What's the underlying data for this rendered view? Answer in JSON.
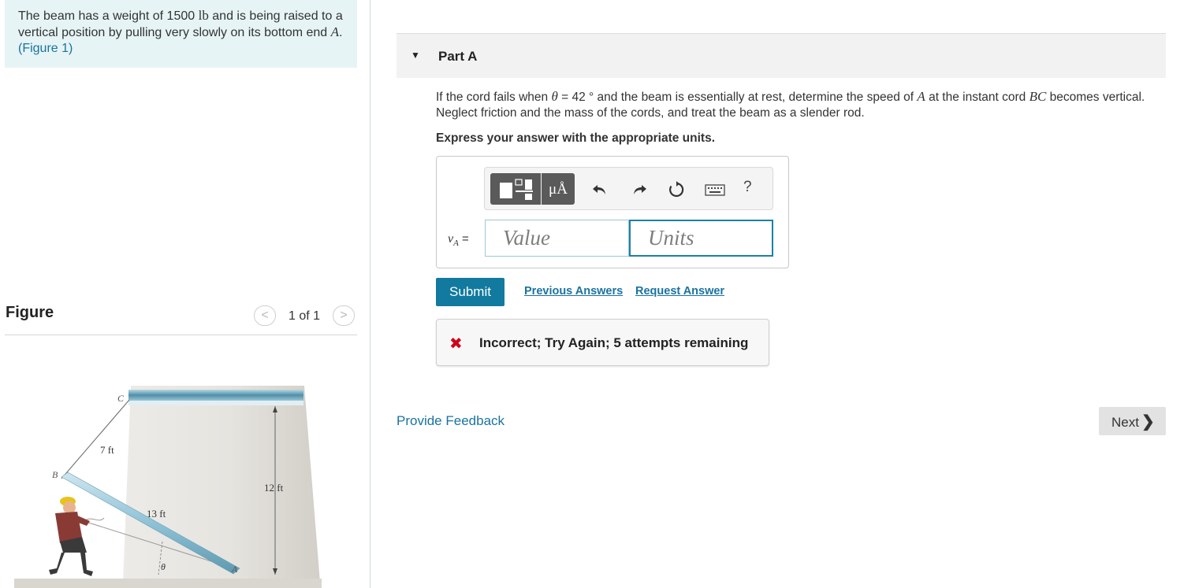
{
  "problem": {
    "text_1": "The beam has a weight of 1500 ",
    "unit_lb": "lb",
    "text_2": " and is being raised to a vertical position by pulling very slowly on its bottom end ",
    "point_a": "A",
    "text_3": ".",
    "figure_link": "(Figure 1)"
  },
  "figure_panel": {
    "title": "Figure",
    "pager_prev": "<",
    "pager_count": "1 of 1",
    "pager_next": ">",
    "labels": {
      "c": "C",
      "b": "B",
      "a": "A",
      "len_bc": "7 ft",
      "len_beam": "13 ft",
      "height": "12 ft",
      "theta": "θ"
    }
  },
  "part": {
    "caret": "▼",
    "title": "Part A",
    "question_1": "If the cord fails when ",
    "theta": "θ",
    "question_2": " = 42 ° and the beam is essentially at rest, determine the speed of ",
    "point_a": "A",
    "question_3": " at the instant cord ",
    "cord_bc": "BC",
    "question_4": " becomes vertical. Neglect friction and the mass of the cords, and treat the beam as a slender rod.",
    "express": "Express your answer with the appropriate units."
  },
  "answer": {
    "toolbar": {
      "units_glyph": "μÅ",
      "help": "?"
    },
    "var_symbol": "v",
    "var_sub": "A",
    "var_eq": " =",
    "value_placeholder": "Value",
    "units_placeholder": "Units"
  },
  "actions": {
    "submit": "Submit",
    "previous_answers": "Previous Answers",
    "request_answer": "Request Answer"
  },
  "feedback": {
    "icon": "✖",
    "message": "Incorrect; Try Again; 5 attempts remaining"
  },
  "footer": {
    "provide_feedback": "Provide Feedback",
    "next": "Next",
    "next_chevron": "❯"
  },
  "colors": {
    "problem_bg": "#e6f4f5",
    "link": "#1a73a0",
    "submit_bg": "#127a9f",
    "error_red": "#d0021b",
    "beam_blue": "#8fc2d6"
  }
}
